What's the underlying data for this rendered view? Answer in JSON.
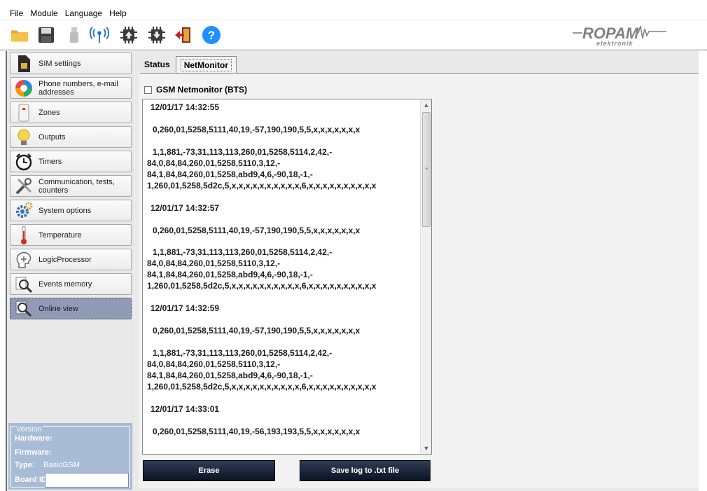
{
  "menu": [
    "File",
    "Module",
    "Language",
    "Help"
  ],
  "brand": {
    "name": "ROPAM",
    "sub": "elektronik"
  },
  "sidebar": {
    "items": [
      {
        "label": "SIM settings",
        "icon": "sim-card-icon"
      },
      {
        "label": "Phone numbers, e-mail addresses",
        "icon": "contacts-icon"
      },
      {
        "label": "Zones",
        "icon": "zone-sensor-icon"
      },
      {
        "label": "Outputs",
        "icon": "light-bulb-icon"
      },
      {
        "label": "Timers",
        "icon": "alarm-clock-icon"
      },
      {
        "label": "Communication, tests, counters",
        "icon": "tools-icon"
      },
      {
        "label": "System options",
        "icon": "gears-icon"
      },
      {
        "label": "Temperature",
        "icon": "thermometer-icon"
      },
      {
        "label": "LogicProcessor",
        "icon": "head-logic-icon"
      },
      {
        "label": "Events memory",
        "icon": "events-magnifier-icon"
      },
      {
        "label": "Online view",
        "icon": "online-magnifier-icon",
        "active": true
      }
    ]
  },
  "version": {
    "legend": "Version",
    "hardware_label": "Hardware:",
    "firmware_label": "Firmware:",
    "type_label": "Type:",
    "type_value": "BasicGSM",
    "boardid_label": "Board ID",
    "boardid_value": ""
  },
  "tabs": [
    "Status",
    "NetMonitor"
  ],
  "selected_tab": "NetMonitor",
  "netmonitor": {
    "checkbox_label": "GSM Netmonitor (BTS)",
    "checked": false,
    "log": [
      {
        "ts": "12/01/17 14:32:55",
        "l1": "0,260,01,5258,5111,40,19,-57,190,190,5,5,x,x,x,x,x,x,x",
        "l2": "1,1,881,-73,31,113,113,260,01,5258,5114,2,42,-",
        "l3": "84,0,84,84,260,01,5258,5110,3,12,-",
        "l4": "84,1,84,84,260,01,5258,abd9,4,6,-90,18,-1,-",
        "l5": "1,260,01,5258,5d2c,5,x,x,x,x,x,x,x,x,x,x,6,x,x,x,x,x,x,x,x,x,x"
      },
      {
        "ts": "12/01/17 14:32:57",
        "l1": "0,260,01,5258,5111,40,19,-57,190,190,5,5,x,x,x,x,x,x,x",
        "l2": "1,1,881,-73,31,113,113,260,01,5258,5114,2,42,-",
        "l3": "84,0,84,84,260,01,5258,5110,3,12,-",
        "l4": "84,1,84,84,260,01,5258,abd9,4,6,-90,18,-1,-",
        "l5": "1,260,01,5258,5d2c,5,x,x,x,x,x,x,x,x,x,x,6,x,x,x,x,x,x,x,x,x,x"
      },
      {
        "ts": "12/01/17 14:32:59",
        "l1": "0,260,01,5258,5111,40,19,-57,190,190,5,5,x,x,x,x,x,x,x",
        "l2": "1,1,881,-73,31,113,113,260,01,5258,5114,2,42,-",
        "l3": "84,0,84,84,260,01,5258,5110,3,12,-",
        "l4": "84,1,84,84,260,01,5258,abd9,4,6,-90,18,-1,-",
        "l5": "1,260,01,5258,5d2c,5,x,x,x,x,x,x,x,x,x,x,6,x,x,x,x,x,x,x,x,x,x"
      },
      {
        "ts": "12/01/17 14:33:01",
        "l1": "0,260,01,5258,5111,40,19,-56,193,193,5,5,x,x,x,x,x,x,x"
      }
    ]
  },
  "buttons": {
    "erase": "Erase",
    "save": "Save log to .txt file"
  },
  "colors": {
    "button_dark": "#1a2436",
    "active_nav": "#8f9bb7",
    "version_panel": "#a9bcd6",
    "help_blue": "#1e90ff"
  }
}
